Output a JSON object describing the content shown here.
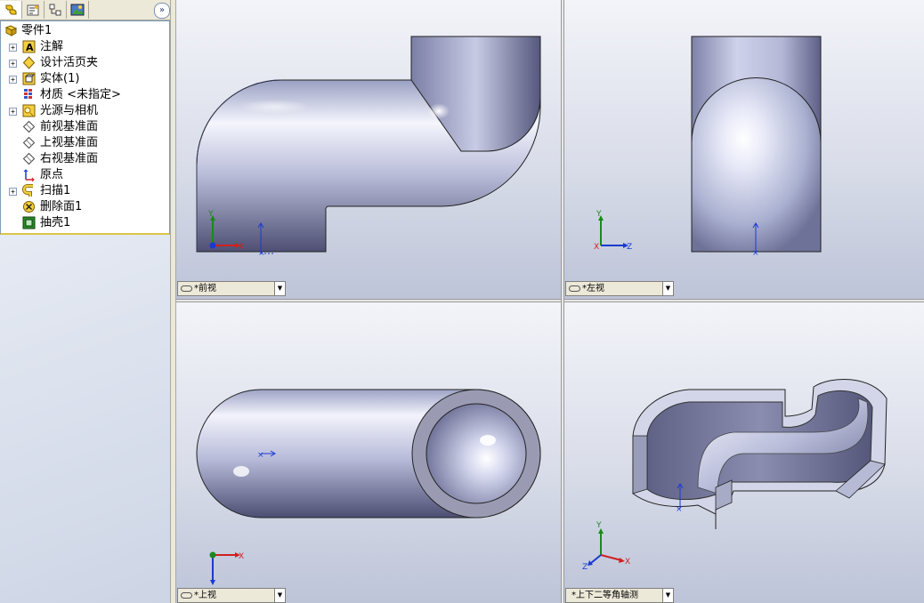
{
  "feature_tree": {
    "root": "零件1",
    "items": [
      {
        "label": "注解",
        "icon": "annotations-icon",
        "expandable": true
      },
      {
        "label": "设计活页夹",
        "icon": "design-binder-icon",
        "expandable": true
      },
      {
        "label": "实体(1)",
        "icon": "solid-bodies-icon",
        "expandable": true
      },
      {
        "label": "材质 <未指定>",
        "icon": "material-icon",
        "expandable": false
      },
      {
        "label": "光源与相机",
        "icon": "lights-cameras-icon",
        "expandable": true
      },
      {
        "label": "前视基准面",
        "icon": "plane-icon",
        "expandable": false
      },
      {
        "label": "上视基准面",
        "icon": "plane-icon",
        "expandable": false
      },
      {
        "label": "右视基准面",
        "icon": "plane-icon",
        "expandable": false
      },
      {
        "label": "原点",
        "icon": "origin-icon",
        "expandable": false
      },
      {
        "label": "扫描1",
        "icon": "sweep-icon",
        "expandable": true
      },
      {
        "label": "删除面1",
        "icon": "delete-face-icon",
        "expandable": false
      },
      {
        "label": "抽壳1",
        "icon": "shell-icon",
        "expandable": false
      }
    ]
  },
  "tabs": [
    {
      "name": "feature-manager-tab",
      "icon": "feature-manager-icon"
    },
    {
      "name": "property-manager-tab",
      "icon": "property-manager-icon"
    },
    {
      "name": "configuration-manager-tab",
      "icon": "configuration-icon"
    },
    {
      "name": "display-manager-tab",
      "icon": "display-manager-icon"
    }
  ],
  "expand_button": "»",
  "viewports": {
    "front": {
      "label": "*前视"
    },
    "left": {
      "label": "*左视"
    },
    "top": {
      "label": "*上视"
    },
    "iso": {
      "label": "*上下二等角轴测"
    }
  },
  "triad": {
    "x": "X",
    "y": "Y",
    "z": "Z"
  },
  "colors": {
    "axis_x": "#d02020",
    "axis_y": "#1a8a1a",
    "axis_z": "#1a3ad0",
    "tree_separator": "#d8c64a"
  }
}
